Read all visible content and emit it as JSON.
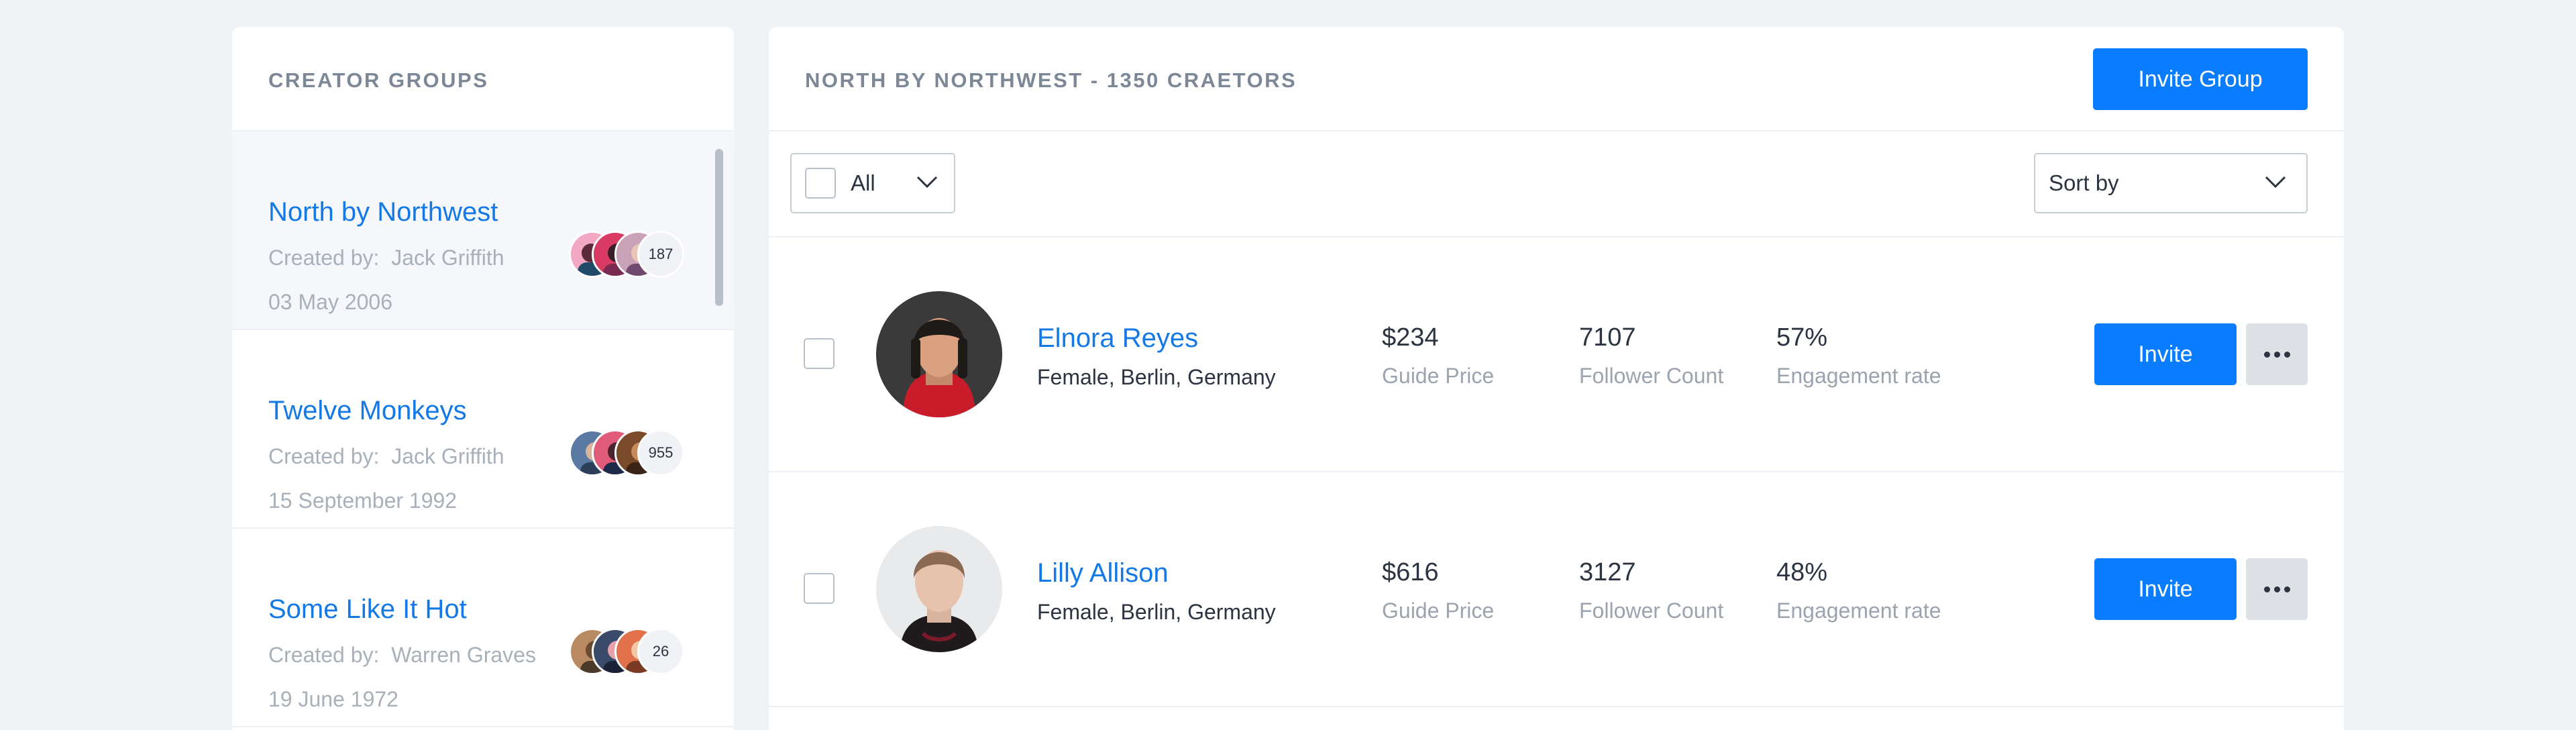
{
  "groups_panel": {
    "title": "CREATOR GROUPS",
    "groups": [
      {
        "name": "North by Northwest",
        "created_by_label": "Created by:",
        "creator": "Jack Griffith",
        "date": "03 May 2006",
        "member_count": "187",
        "active": true
      },
      {
        "name": "Twelve Monkeys",
        "created_by_label": "Created by:",
        "creator": "Jack Griffith",
        "date": "15 September 1992",
        "member_count": "955",
        "active": false
      },
      {
        "name": "Some Like It Hot",
        "created_by_label": "Created by:",
        "creator": "Warren Graves",
        "date": "19 June 1972",
        "member_count": "26",
        "active": false
      }
    ]
  },
  "main": {
    "header_title": "NORTH BY NORTHWEST - 1350 CRAETORS",
    "invite_group_label": "Invite Group",
    "filter": {
      "selected": "All"
    },
    "sort": {
      "selected": "Sort by"
    },
    "creators": [
      {
        "name": "Elnora Reyes",
        "details": "Female, Berlin, Germany",
        "guide_price": "$234",
        "guide_price_label": "Guide Price",
        "follower_count": "7107",
        "follower_count_label": "Follower Count",
        "engagement_rate": "57%",
        "engagement_rate_label": "Engagement rate",
        "invite_label": "Invite"
      },
      {
        "name": "Lilly Allison",
        "details": "Female, Berlin, Germany",
        "guide_price": "$616",
        "guide_price_label": "Guide Price",
        "follower_count": "3127",
        "follower_count_label": "Follower Count",
        "engagement_rate": "48%",
        "engagement_rate_label": "Engagement rate",
        "invite_label": "Invite"
      }
    ]
  },
  "colors": {
    "accent": "#0a7cff",
    "link": "#1479e6",
    "background": "#f0f3f6"
  }
}
